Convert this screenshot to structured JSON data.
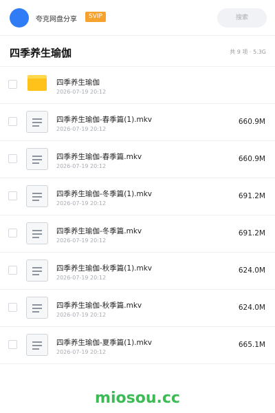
{
  "header": {
    "share_name": "夸克网盘分享",
    "badge": "SVIP",
    "search_placeholder": "搜索"
  },
  "folder": {
    "title": "四季养生瑜伽",
    "meta": "共 9 项 · 5.3G"
  },
  "items": [
    {
      "type": "folder",
      "name": "四季养生瑜伽",
      "date": "2026-07-19 20:12",
      "size": ""
    },
    {
      "type": "file",
      "name": "四季养生瑜伽-春季篇(1).mkv",
      "date": "2026-07-19 20:12",
      "size": "660.9M"
    },
    {
      "type": "file",
      "name": "四季养生瑜伽-春季篇.mkv",
      "date": "2026-07-19 20:12",
      "size": "660.9M"
    },
    {
      "type": "file",
      "name": "四季养生瑜伽-冬季篇(1).mkv",
      "date": "2026-07-19 20:12",
      "size": "691.2M"
    },
    {
      "type": "file",
      "name": "四季养生瑜伽-冬季篇.mkv",
      "date": "2026-07-19 20:12",
      "size": "691.2M"
    },
    {
      "type": "file",
      "name": "四季养生瑜伽-秋季篇(1).mkv",
      "date": "2026-07-19 20:12",
      "size": "624.0M"
    },
    {
      "type": "file",
      "name": "四季养生瑜伽-秋季篇.mkv",
      "date": "2026-07-19 20:12",
      "size": "624.0M"
    },
    {
      "type": "file",
      "name": "四季养生瑜伽-夏季篇(1).mkv",
      "date": "2026-07-19 20:12",
      "size": "665.1M"
    }
  ],
  "footer": {
    "brand": "miosou.cc"
  },
  "colors": {
    "avatar": "#2f7cf6",
    "badge": "#f5a22e",
    "brand": "#3cba54",
    "folder": "#ffc21a"
  }
}
